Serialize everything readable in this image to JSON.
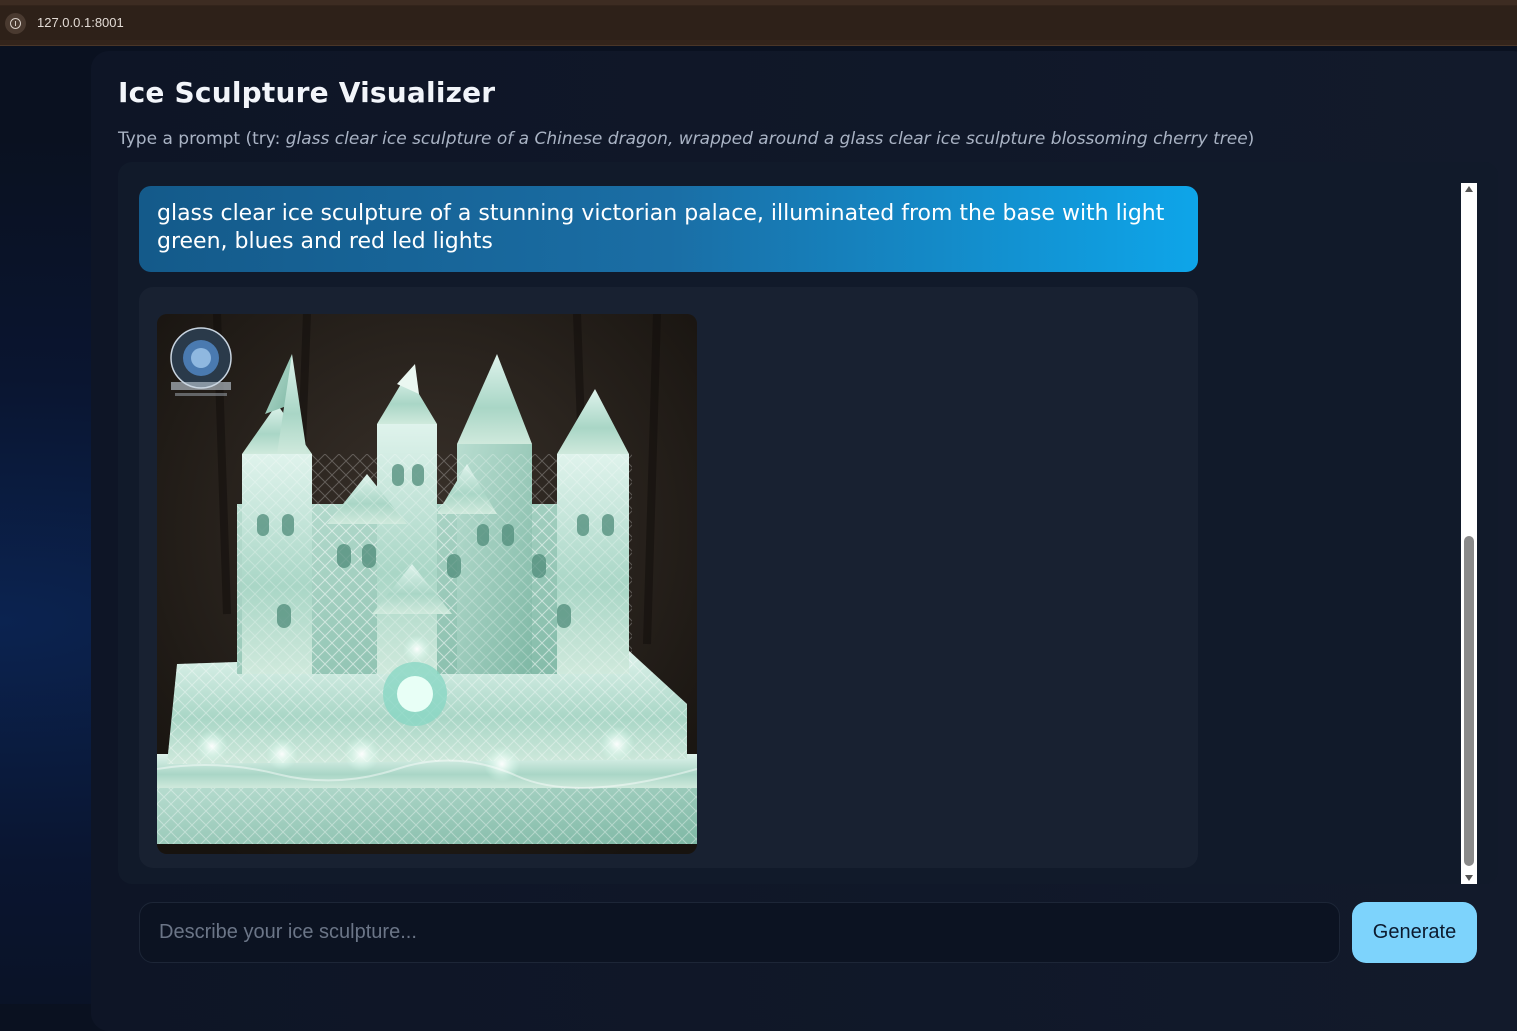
{
  "browser": {
    "url": "127.0.0.1:8001"
  },
  "app": {
    "title": "Ice Sculpture Visualizer",
    "subtitle_prefix": "Type a prompt (try: ",
    "subtitle_example": "glass clear ice sculpture of a Chinese dragon, wrapped around a glass clear ice sculpture blossoming cherry tree",
    "subtitle_suffix": ")"
  },
  "chat": {
    "messages": [
      {
        "role": "user",
        "text": "glass clear ice sculpture of a stunning victorian palace, illuminated from the base with light green, blues and red led lights"
      },
      {
        "role": "assistant",
        "image_subject": "ice sculpture of a victorian palace lit with green and blue lights"
      }
    ]
  },
  "composer": {
    "placeholder": "Describe your ice sculpture...",
    "value": "",
    "generate_label": "Generate"
  },
  "colors": {
    "accent": "#7dd3fc",
    "user_bubble_start": "#145a8a",
    "user_bubble_end": "#0ea5e9",
    "background": "#0a1120"
  }
}
